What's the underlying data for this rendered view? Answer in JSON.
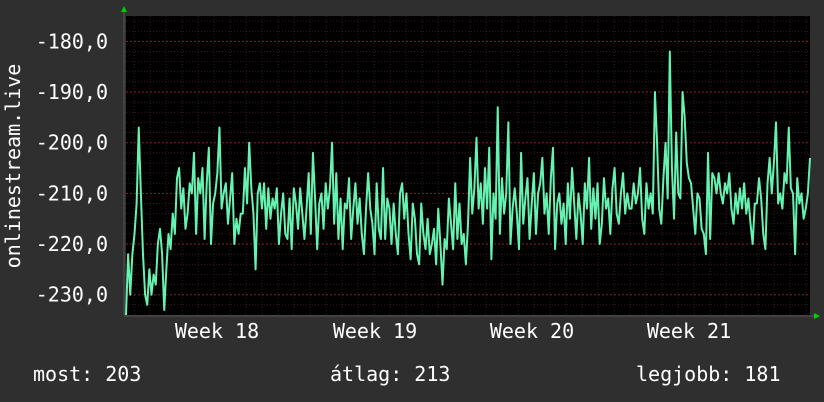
{
  "colors": {
    "background": "#2f2f2f",
    "plot_background": "#000000",
    "grid_minor": "#3a1a1a",
    "grid_major": "#8a2020",
    "line": "#66f2b0",
    "axis_arrow": "#00cc00",
    "text": "#ffffff"
  },
  "footer": {
    "current": "most: 203",
    "average": "átlag: 213",
    "best": "legjobb: 181"
  },
  "chart_data": {
    "type": "line",
    "ylabel": "onlinestream.live",
    "ylim": [
      -234.0,
      -175.0
    ],
    "y_ticks": [
      -180,
      -190,
      -200,
      -210,
      -220,
      -230
    ],
    "y_tick_labels": [
      "-180,0",
      "-190,0",
      "-200,0",
      "-210,0",
      "-220,0",
      "-230,0"
    ],
    "x_ticks": [
      "Week 18",
      "Week 19",
      "Week 20",
      "Week 21"
    ],
    "grid": true,
    "series": [
      {
        "values": [
          -234,
          -222,
          -230,
          -222,
          -218,
          -212,
          -197,
          -210,
          -222,
          -230,
          -232,
          -225,
          -230,
          -226,
          -228,
          -220,
          -217,
          -222,
          -233,
          -225,
          -218,
          -221,
          -214,
          -218,
          -207,
          -205,
          -213,
          -209,
          -217,
          -214,
          -208,
          -210,
          -202,
          -218,
          -207,
          -210,
          -205,
          -219,
          -208,
          -201,
          -220,
          -212,
          -210,
          -206,
          -197,
          -213,
          -210,
          -208,
          -216,
          -211,
          -206,
          -220,
          -215,
          -218,
          -214,
          -214,
          -205,
          -212,
          -200,
          -209,
          -214,
          -225,
          -210,
          -208,
          -213,
          -208,
          -217,
          -209,
          -215,
          -211,
          -213,
          -209,
          -220,
          -214,
          -210,
          -218,
          -219,
          -211,
          -221,
          -209,
          -212,
          -217,
          -209,
          -214,
          -219,
          -213,
          -206,
          -218,
          -202,
          -211,
          -221,
          -212,
          -210,
          -217,
          -208,
          -213,
          -209,
          -200,
          -216,
          -206,
          -219,
          -211,
          -221,
          -212,
          -213,
          -207,
          -219,
          -213,
          -208,
          -216,
          -211,
          -218,
          -222,
          -213,
          -206,
          -213,
          -216,
          -222,
          -208,
          -217,
          -219,
          -205,
          -219,
          -211,
          -213,
          -220,
          -212,
          -218,
          -222,
          -210,
          -208,
          -215,
          -210,
          -218,
          -223,
          -212,
          -215,
          -222,
          -224,
          -212,
          -218,
          -221,
          -215,
          -222,
          -220,
          -217,
          -224,
          -213,
          -220,
          -228,
          -219,
          -221,
          -211,
          -216,
          -221,
          -208,
          -219,
          -212,
          -220,
          -218,
          -224,
          -216,
          -203,
          -214,
          -209,
          -199,
          -213,
          -208,
          -216,
          -205,
          -213,
          -201,
          -223,
          -210,
          -215,
          -193,
          -218,
          -207,
          -214,
          -210,
          -196,
          -220,
          -213,
          -209,
          -214,
          -221,
          -202,
          -216,
          -211,
          -207,
          -219,
          -212,
          -206,
          -218,
          -210,
          -208,
          -203,
          -214,
          -210,
          -218,
          -207,
          -201,
          -221,
          -212,
          -210,
          -216,
          -212,
          -220,
          -208,
          -215,
          -205,
          -212,
          -219,
          -210,
          -214,
          -220,
          -208,
          -213,
          -203,
          -217,
          -209,
          -215,
          -208,
          -220,
          -216,
          -207,
          -213,
          -211,
          -218,
          -209,
          -205,
          -214,
          -216,
          -210,
          -206,
          -214,
          -210,
          -213,
          -213,
          -208,
          -212,
          -210,
          -205,
          -215,
          -218,
          -208,
          -213,
          -210,
          -214,
          -190,
          -200,
          -213,
          -216,
          -207,
          -200,
          -211,
          -182,
          -205,
          -215,
          -198,
          -210,
          -211,
          -190,
          -195,
          -204,
          -207,
          -208,
          -213,
          -218,
          -210,
          -211,
          -217,
          -218,
          -222,
          -202,
          -219,
          -206,
          -207,
          -210,
          -206,
          -210,
          -212,
          -208,
          -210,
          -206,
          -213,
          -216,
          -210,
          -214,
          -209,
          -213,
          -208,
          -214,
          -211,
          -216,
          -220,
          -212,
          -212,
          -207,
          -211,
          -218,
          -221,
          -208,
          -203,
          -210,
          -204,
          -196,
          -212,
          -210,
          -213,
          -206,
          -208,
          -197,
          -209,
          -210,
          -222,
          -207,
          -212,
          -210,
          -215,
          -213,
          -210,
          -203
        ],
        "color": "#66f2b0"
      }
    ]
  }
}
